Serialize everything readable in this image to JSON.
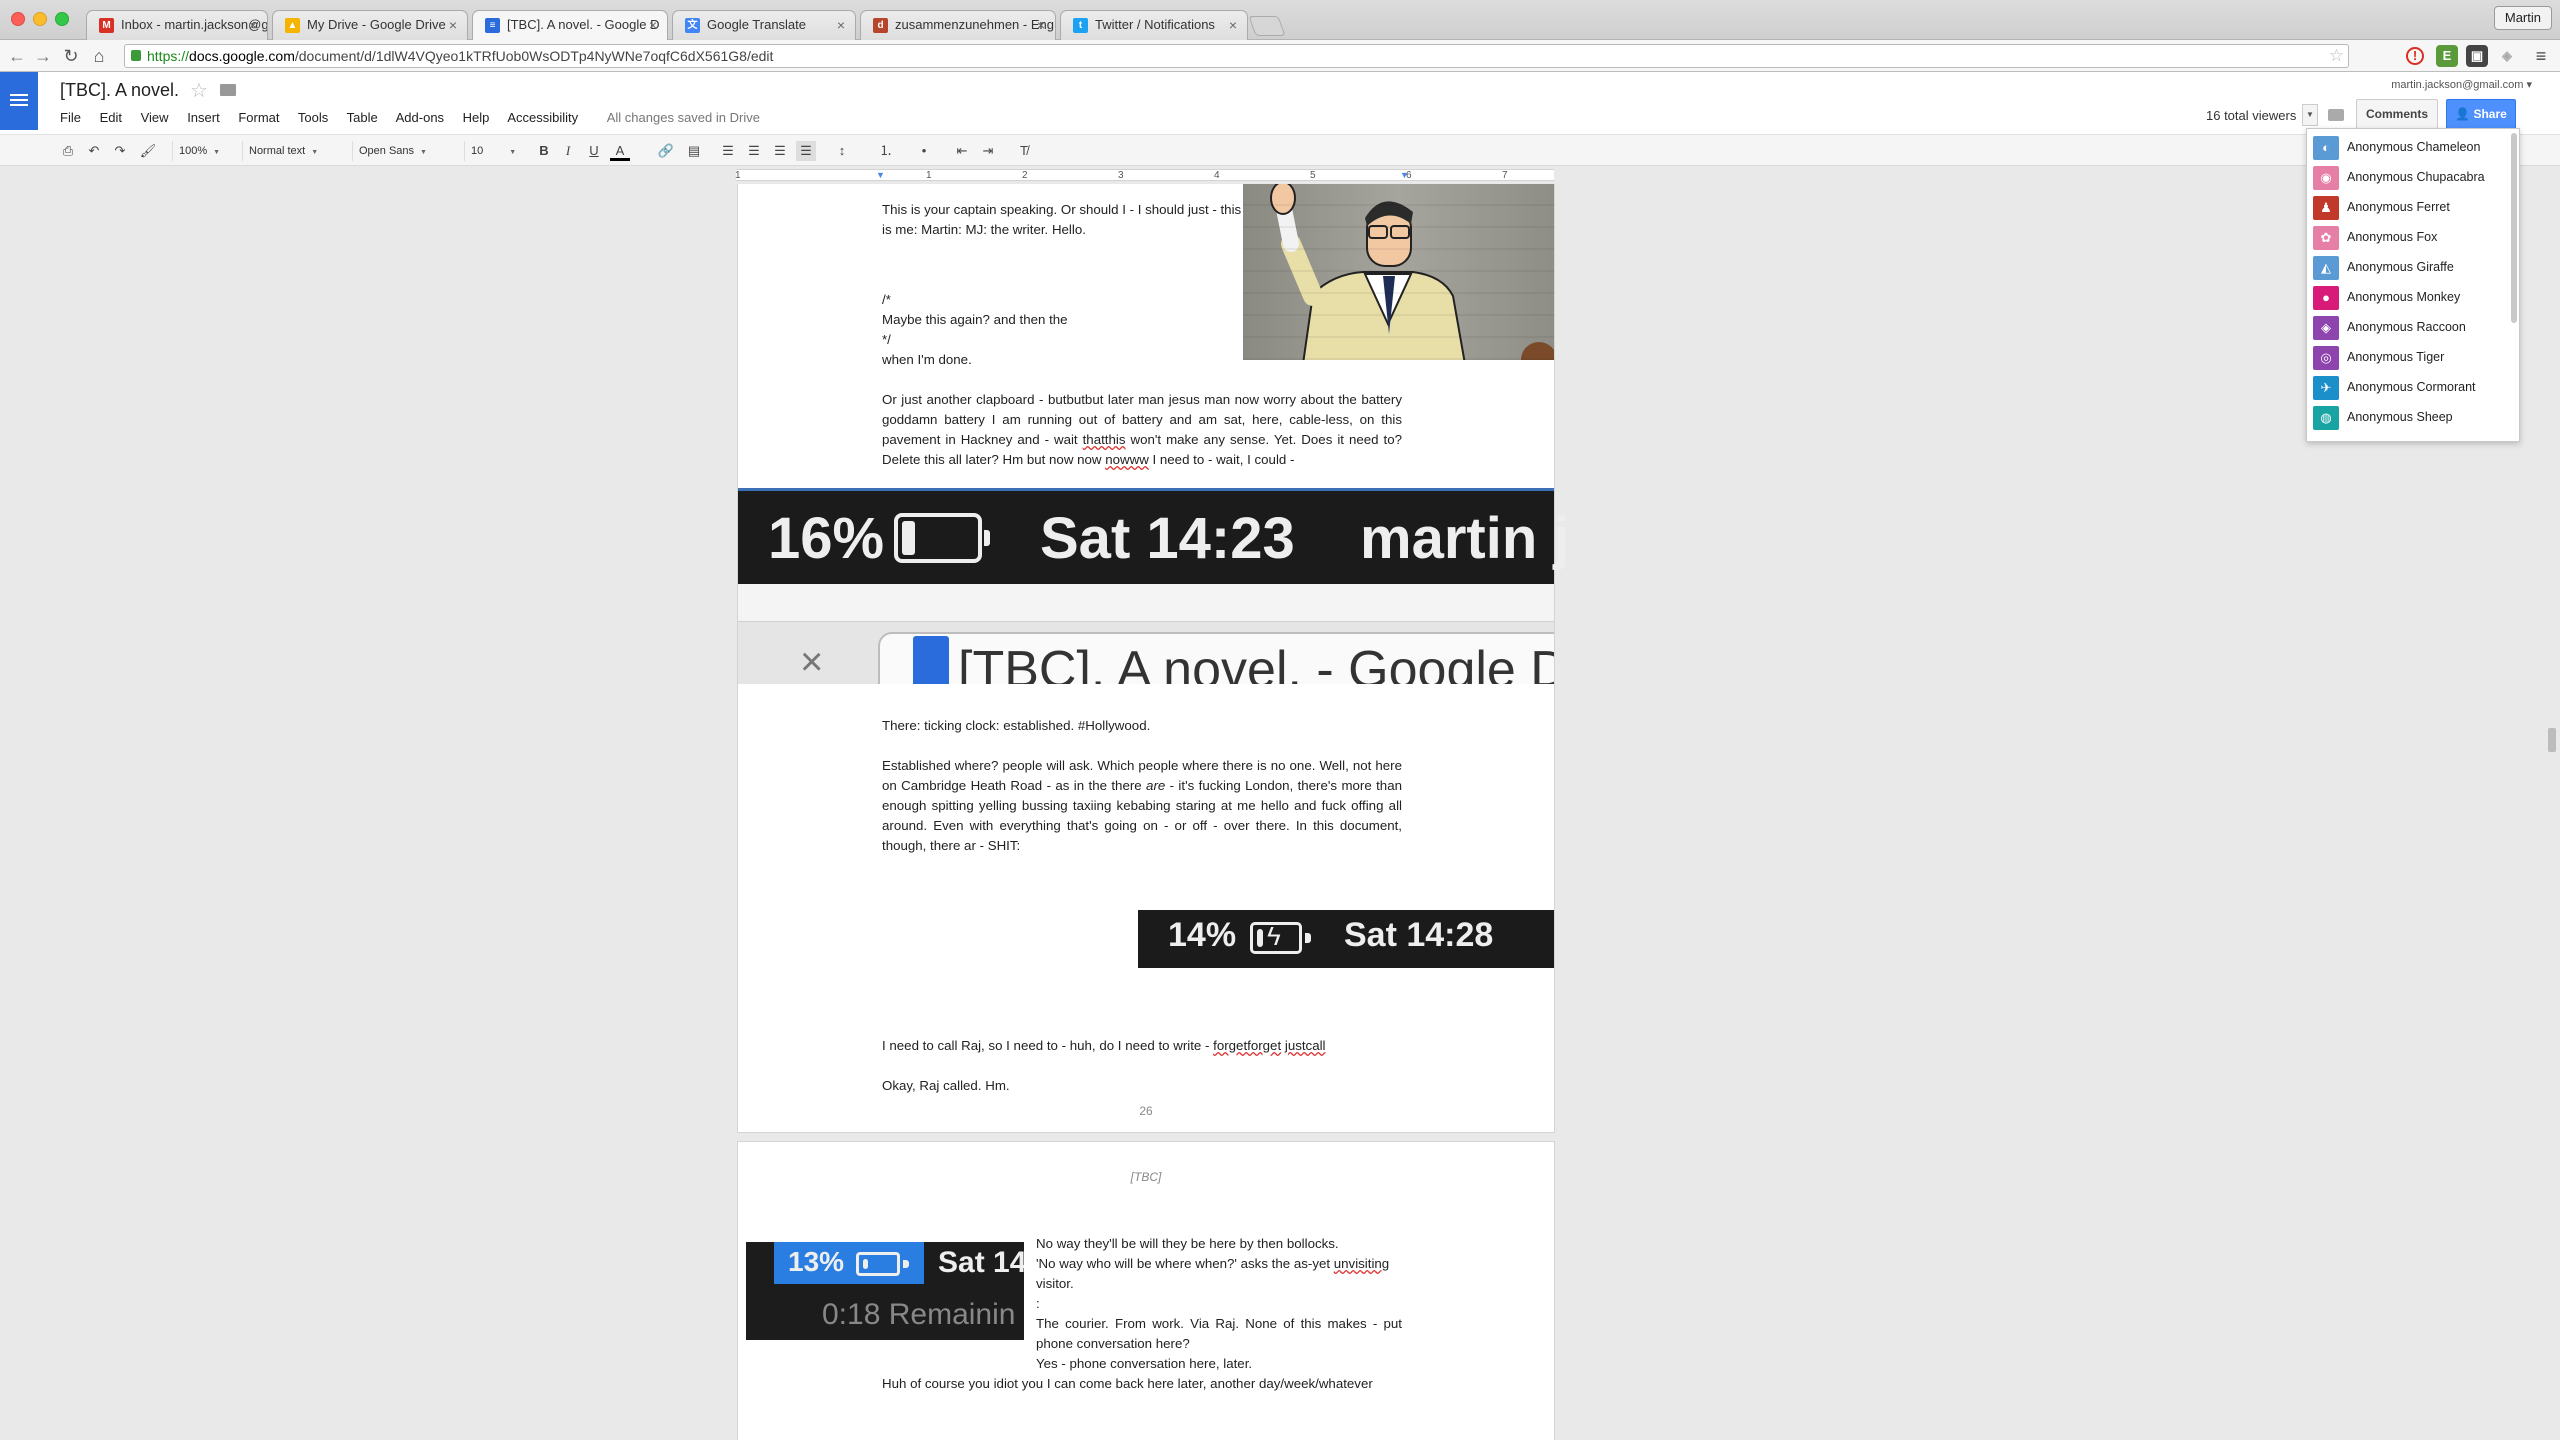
{
  "browser": {
    "tabs": [
      {
        "label": "Inbox - martin.jackson@g",
        "favicon": "M",
        "color": "#d93025"
      },
      {
        "label": "My Drive - Google Drive",
        "favicon": "▲",
        "color": "#f4b400"
      },
      {
        "label": "[TBC]. A novel. - Google D",
        "favicon": "≡",
        "color": "#2a6cdc"
      },
      {
        "label": "Google Translate",
        "favicon": "文",
        "color": "#4285f4"
      },
      {
        "label": "zusammenzunehmen - Eng",
        "favicon": "d",
        "color": "#b5462b"
      },
      {
        "label": "Twitter / Notifications",
        "favicon": "t",
        "color": "#1da1f2"
      }
    ],
    "profile": "Martin",
    "url": {
      "scheme": "https://",
      "host": "docs.google.com",
      "path": "/document/d/1dlW4VQyeo1kTRfUob0WsODTp4NyWNe7oqfC6dX561G8/edit"
    }
  },
  "docs": {
    "title": "[TBC]. A novel.",
    "menu": [
      "File",
      "Edit",
      "View",
      "Insert",
      "Format",
      "Tools",
      "Table",
      "Add-ons",
      "Help",
      "Accessibility"
    ],
    "saved_status": "All changes saved in Drive",
    "account": "martin.jackson@gmail.com",
    "viewers_label": "16 total viewers",
    "comments_label": "Comments",
    "share_label": "Share"
  },
  "format_toolbar": {
    "zoom": "100%",
    "style": "Normal text",
    "font": "Open Sans",
    "size": "10",
    "bold": "B",
    "italic": "I",
    "underline": "U",
    "text_color": "A"
  },
  "ruler": [
    "1",
    "1",
    "2",
    "3",
    "4",
    "5",
    "6",
    "7"
  ],
  "viewers": [
    {
      "name": "Anonymous Chameleon",
      "color": "#5b9bd5"
    },
    {
      "name": "Anonymous Chupacabra",
      "color": "#e57fa6"
    },
    {
      "name": "Anonymous Ferret",
      "color": "#c0392b"
    },
    {
      "name": "Anonymous Fox",
      "color": "#e57fa6"
    },
    {
      "name": "Anonymous Giraffe",
      "color": "#5b9bd5"
    },
    {
      "name": "Anonymous Monkey",
      "color": "#d81b79"
    },
    {
      "name": "Anonymous Raccoon",
      "color": "#8e44ad"
    },
    {
      "name": "Anonymous Tiger",
      "color": "#8e44ad"
    },
    {
      "name": "Anonymous Cormorant",
      "color": "#1a8fc9"
    },
    {
      "name": "Anonymous Sheep",
      "color": "#1aa3a3"
    }
  ],
  "document": {
    "p1": "This is your captain speaking. Or should I - I should just - this is me: Martin: MJ: the writer. Hello.",
    "comment_open": "/*",
    "comment_body": "Maybe this again? and then the",
    "comment_close": "*/",
    "when_done": "when I'm done.",
    "p2_a": "Or just another clapboard - butbutbut later man jesus man now worry about the battery goddamn battery I am running out of battery and am sat, here, cable-less, on this pavement in Hackney and - wait ",
    "p2_sq1": "thatthis",
    "p2_b": " won't make any sense. Yet. Does it need to? Delete this all later? Hm but now now ",
    "p2_sq2": "nowww",
    "p2_c": " I need to - wait, I could -",
    "shot1": {
      "percent": "16%",
      "time": "Sat 14:23",
      "user": "martin j",
      "level": 0.16
    },
    "shot1_tab": "[TBC]. A novel. - Google D",
    "p3": "There: ticking clock: established. #Hollywood.",
    "p4_a": "Established where? people will ask. Which people where there is no one. Well, not here on Cambridge Heath Road - as in the there ",
    "p4_em": "are",
    "p4_b": " - it's fucking London, there's more than enough spitting yelling bussing taxiing kebabing staring at me hello and fuck offing all around. Even with everything that's going on - or off - over there. In this document, though, there ar - SHIT:",
    "shot2": {
      "percent": "14%",
      "time": "Sat 14:28",
      "level": 0.14
    },
    "p5_a": "I need to call Raj, so I need to - huh, do I need to write - ",
    "p5_sq1": "forgetforget",
    "p5_sq2": "justcall",
    "p6": "Okay, Raj called. Hm.",
    "page_number": "26",
    "page2_header": "[TBC]",
    "shot3": {
      "percent": "13%",
      "time": "Sat 14",
      "remaining": "0:18 Remainin",
      "level": 0.13
    },
    "p7": "No way they'll be will they be here by then bollocks.",
    "p8_a": "'No way who will be where when?' asks the as-yet ",
    "p8_sq": "unvisiting",
    "p8_b": " visitor.",
    "p9": ":",
    "p10": "The courier. From work. Via Raj. None of this makes - put phone conversation here?",
    "p11": "Yes - phone conversation here, later.",
    "p12": "Huh of course you idiot you I can come back here later, another day/week/whatever"
  }
}
